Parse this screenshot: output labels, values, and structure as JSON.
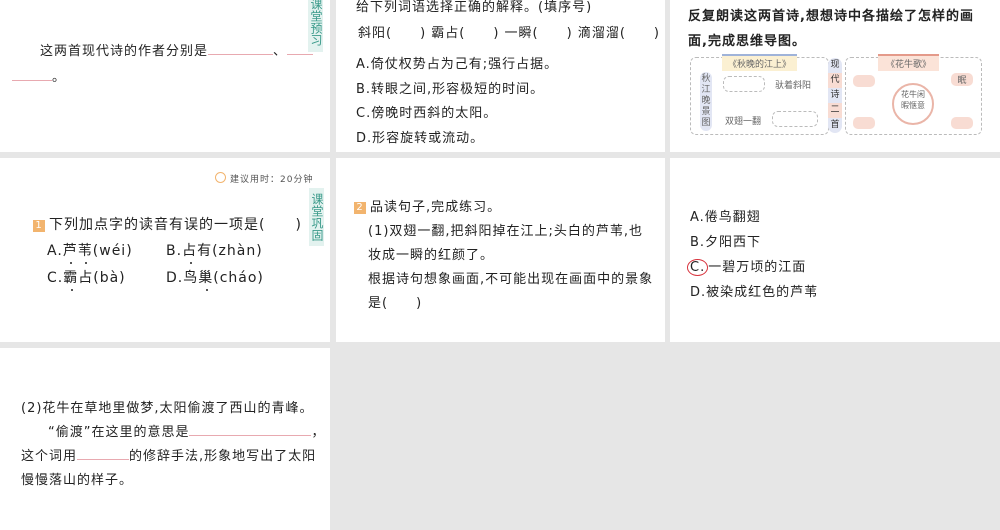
{
  "preview_tag": "课堂预习",
  "consolidate_tag": "课堂巩固",
  "p1": {
    "text": "这两首现代诗的作者分别是",
    "sep": "、",
    "end": "。"
  },
  "p2": {
    "instruction": "给下列词语选择正确的解释。(填序号)",
    "words": "斜阳(　　) 霸占(　　) 一瞬(　　) 滴溜溜(　　)",
    "options": [
      "A.倚仗权势占为己有;强行占据。",
      "B.转眼之间,形容极短的时间。",
      "C.傍晚时西斜的太阳。",
      "D.形容旋转或流动。"
    ]
  },
  "p3": {
    "line1": "反复朗读这两首诗,想想诗中各描绘了怎样的画",
    "line2": "面,完成思维导图。",
    "mindmap": {
      "left_title": "《秋晚的江上》",
      "left_root": "秋江晚景图",
      "left_item1": "驮着斜阳",
      "left_item2": "双翅一翻",
      "center": [
        "现",
        "代",
        "诗",
        "二",
        "首"
      ],
      "right_title": "《花牛歌》",
      "right_center": "花牛闲暇惬意",
      "right_item": "眠"
    }
  },
  "p4": {
    "time": "建议用时：20分钟",
    "num": "1",
    "question": "下列加点字的读音有误的一项是(　　)",
    "options": [
      {
        "label": "A.",
        "w1": "芦",
        "w2": "苇",
        "py": "(wéi)"
      },
      {
        "label": "B.",
        "w1": "占",
        "w2": "有",
        "py": "(zhàn)"
      },
      {
        "label": "C.",
        "w1": "霸",
        "w2": "占",
        "py": "(bà)"
      },
      {
        "label": "D.",
        "w1": "鸟",
        "w2": "巢",
        "py": "(cháo)"
      }
    ]
  },
  "p5": {
    "num": "2",
    "title": "品读句子,完成练习。",
    "l1": "(1)双翅一翻,把斜阳掉在江上;头白的芦苇,也",
    "l2": "妆成一瞬的红颜了。",
    "l3": "根据诗句想象画面,不可能出现在画面中的景象",
    "l4": "是(　　)"
  },
  "p6": {
    "options": [
      "A.倦鸟翻翅",
      "B.夕阳西下",
      "C.",
      "一碧万顷的江面",
      "D.被染成红色的芦苇"
    ],
    "marked": "C"
  },
  "p7": {
    "l1": "(2)花牛在草地里做梦,太阳偷渡了西山的青峰。",
    "l2a": "“偷渡”在这里的意思是",
    "l2b": "，",
    "l3a": "这个词用",
    "l3b": "的修辞手法,形象地写出了太阳",
    "l4": "慢慢落山的样子。"
  }
}
